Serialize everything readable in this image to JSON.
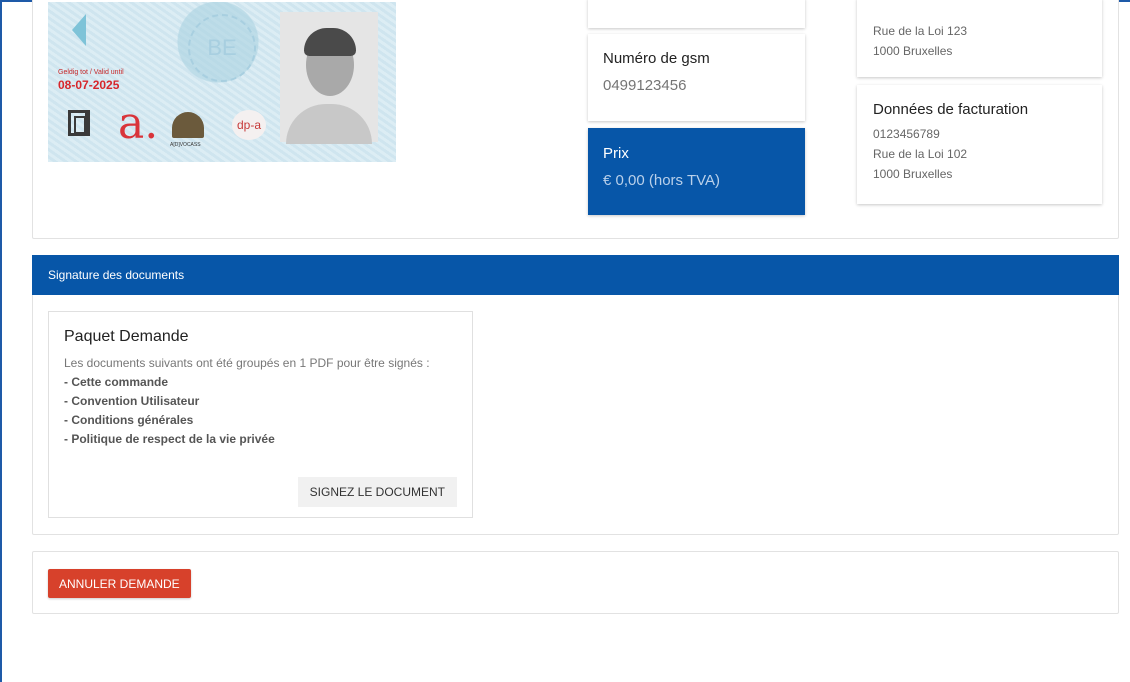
{
  "id_card": {
    "valid_label": "Geldig tot / Valid until",
    "valid_date": "08-07-2025",
    "country_code": "BE",
    "logo_letter": "a.",
    "avocass_label": "A[D]VOCASS",
    "dpa_label": "dp-a"
  },
  "contact": {
    "gsm_label": "Numéro de gsm",
    "gsm_value": "0499123456",
    "price_label": "Prix",
    "price_value": "€ 0,00 (hors TVA)"
  },
  "address": {
    "line1": "Rue de la Loi 123",
    "line2": "1000 Bruxelles"
  },
  "billing": {
    "title": "Données de facturation",
    "line1": "0123456789",
    "line2": "Rue de la Loi 102",
    "line3": "1000 Bruxelles"
  },
  "signature": {
    "header": "Signature des documents",
    "package_title": "Paquet Demande",
    "intro": "Les documents suivants ont été groupés en 1 PDF pour être signés :",
    "documents": [
      "- Cette commande",
      "- Convention Utilisateur",
      "- Conditions générales",
      "- Politique de respect de la vie privée"
    ],
    "sign_button": "SIGNEZ LE DOCUMENT"
  },
  "actions": {
    "cancel_button": "ANNULER DEMANDE"
  },
  "colors": {
    "primary": "#0756a8",
    "danger": "#d7412b"
  }
}
